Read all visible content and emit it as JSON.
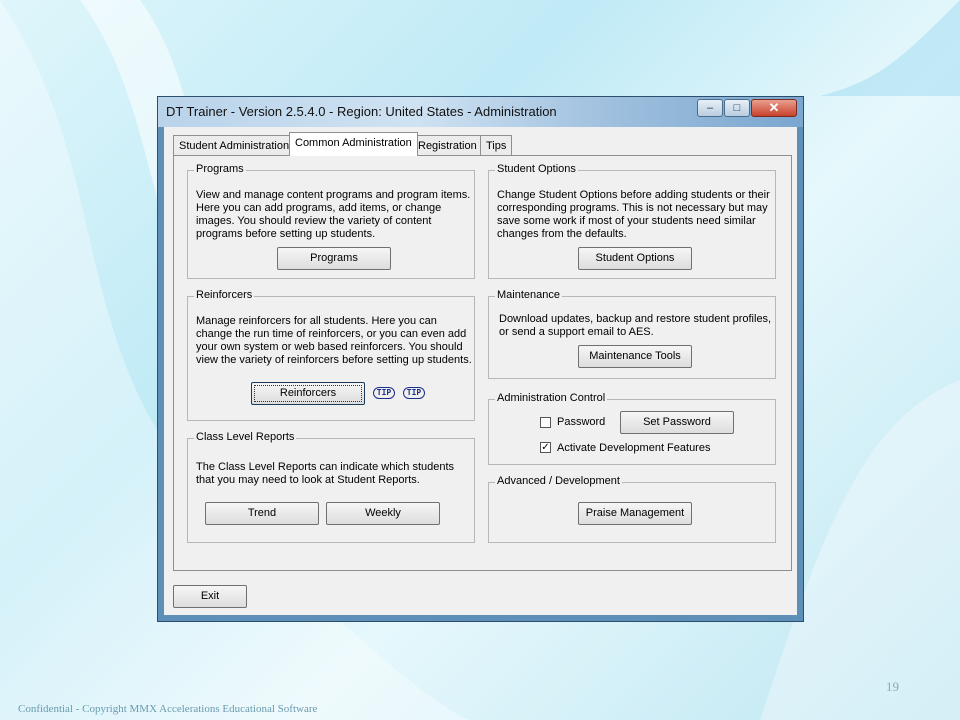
{
  "window": {
    "title": "DT Trainer - Version 2.5.4.0 - Region: United States - Administration",
    "controls": {
      "minimize": "–",
      "maximize": "□",
      "close": "✕"
    }
  },
  "tabs": [
    {
      "label": "Student Administration",
      "active": false
    },
    {
      "label": "Common Administration",
      "active": true
    },
    {
      "label": "Registration",
      "active": false
    },
    {
      "label": "Tips",
      "active": false
    }
  ],
  "groups": {
    "programs": {
      "title": "Programs",
      "lines": [
        "View and manage content programs and program items.",
        "Here you can add programs, add items, or change",
        "images.  You should review the variety of content",
        "programs before setting up students."
      ],
      "button": "Programs"
    },
    "student_options": {
      "title": "Student Options",
      "lines": [
        "Change Student Options before adding students or their",
        "corresponding programs.  This is not necessary but may",
        "save some work if most of your students need similar",
        "changes from the defaults."
      ],
      "button": "Student Options"
    },
    "reinforcers": {
      "title": "Reinforcers",
      "lines": [
        "Manage reinforcers for all students.  Here you can",
        "change the run time of reinforcers, or you can even add",
        "your own system or web based reinforcers.  You should",
        "view the variety of reinforcers before setting up students."
      ],
      "button": "Reinforcers",
      "tips": [
        "TIP",
        "TIP"
      ]
    },
    "maintenance": {
      "title": "Maintenance",
      "lines": [
        "Download updates, backup and restore student profiles,",
        "or send a support email to AES."
      ],
      "button": "Maintenance Tools"
    },
    "admin_control": {
      "title": "Administration Control",
      "password_label": "Password",
      "password_checked": false,
      "set_password_button": "Set Password",
      "dev_features_label": "Activate Development Features",
      "dev_features_checked": true,
      "check_mark": "✓"
    },
    "class_reports": {
      "title": "Class Level Reports",
      "lines": [
        "The Class Level Reports can indicate which students",
        "that you may need to look at Student Reports."
      ],
      "trend_button": "Trend",
      "weekly_button": "Weekly"
    },
    "advanced": {
      "title": "Advanced / Development",
      "button": "Praise Management"
    }
  },
  "exit_button": "Exit",
  "slide": {
    "footer": "Confidential - Copyright MMX Accelerations Educational Software",
    "page_number": "19"
  },
  "colors": {
    "titlebar": "#b9d3ea",
    "close_button": "#c8412b",
    "background": "#bfeaf6"
  }
}
